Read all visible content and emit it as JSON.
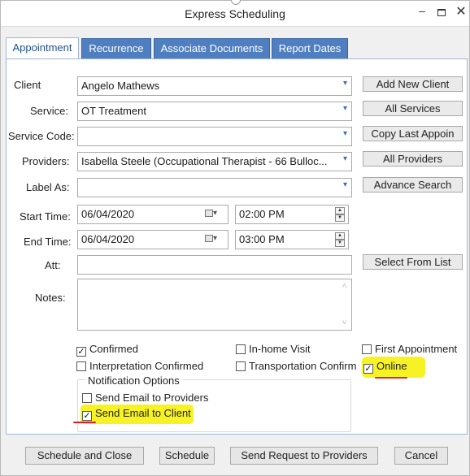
{
  "window": {
    "title": "Express Scheduling"
  },
  "tabs": [
    "Appointment",
    "Recurrence",
    "Associate Documents",
    "Report Dates"
  ],
  "form": {
    "client": {
      "label": "Client",
      "value": "Angelo Mathews"
    },
    "service": {
      "label": "Service:",
      "value": "OT Treatment"
    },
    "service_code": {
      "label": "Service Code:",
      "value": ""
    },
    "providers": {
      "label": "Providers:",
      "value": "Isabella Steele (Occupational Therapist - 66 Bulloc..."
    },
    "label_as": {
      "label": "Label As:",
      "value": ""
    },
    "start": {
      "label": "Start Time:",
      "date": "06/04/2020",
      "time": "02:00 PM"
    },
    "end": {
      "label": "End Time:",
      "date": "06/04/2020",
      "time": "03:00 PM"
    },
    "att": {
      "label": "Att:",
      "value": ""
    },
    "notes": {
      "label": "Notes:",
      "value": ""
    }
  },
  "side_buttons": {
    "add_new_client": "Add New Client",
    "all_services": "All Services",
    "copy_last": "Copy Last Appoin",
    "all_providers": "All Providers",
    "advance_search": "Advance Search",
    "select_from_list": "Select From List"
  },
  "checkboxes": {
    "confirmed": {
      "label": "Confirmed",
      "checked": true
    },
    "in_home_visit": {
      "label": "In-home Visit",
      "checked": false
    },
    "first_appointment": {
      "label": "First Appointment",
      "checked": false
    },
    "interpretation_confirmed": {
      "label": "Interpretation Confirmed",
      "checked": false
    },
    "transportation_confirm": {
      "label": "Transportation Confirm",
      "checked": false
    },
    "online": {
      "label": "Online",
      "checked": true
    }
  },
  "notification": {
    "title": "Notification Options",
    "send_email_providers": {
      "label": "Send Email to Providers",
      "checked": false
    },
    "send_email_client": {
      "label": "Send Email to Client",
      "checked": true
    }
  },
  "bottom_buttons": {
    "schedule_and_close": "Schedule and Close",
    "schedule": "Schedule",
    "send_request": "Send Request to Providers",
    "cancel": "Cancel"
  },
  "colors": {
    "tab_blue": "#4f7fc0",
    "highlight": "#f6f224",
    "annotation_red": "#e02020"
  }
}
